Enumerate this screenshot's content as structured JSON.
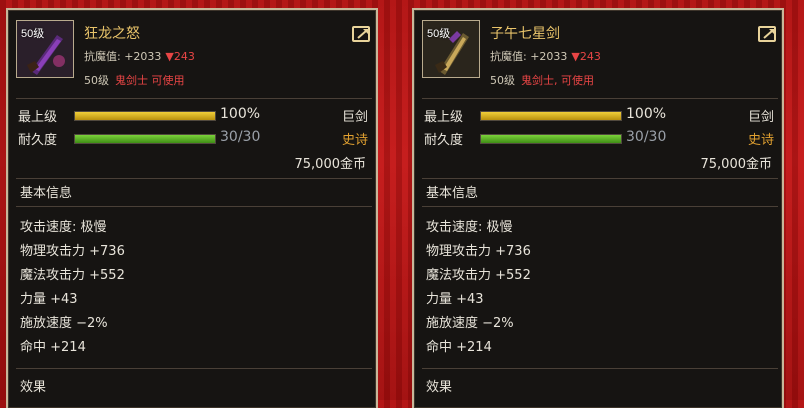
{
  "colors": {
    "name": "#e9c46a",
    "red": "#e84545",
    "bar_yellow": "#d9b21a",
    "bar_green": "#5fb82a",
    "epic": "#e0a030"
  },
  "items": [
    {
      "level_badge": "50级",
      "name": "狂龙之怒",
      "stat_label": "抗魔值: +2033",
      "stat_change": "▼243",
      "req_level": "50级",
      "req_class": "鬼剑士 可使用",
      "top_label": "最上级",
      "top_value": "100%",
      "top_fraction": 1.0,
      "type": "巨剑",
      "dur_label": "耐久度",
      "dur_value": "30/30",
      "dur_fraction": 1.0,
      "rarity": "史诗",
      "price": "75,000金币",
      "basic_title": "基本信息",
      "attrs": [
        "攻击速度: 极慢",
        "物理攻击力 +736",
        "魔法攻击力 +552",
        "力量 +43",
        "施放速度 −2%",
        "命中 +214"
      ],
      "effect_title": "效果",
      "icon": "purple-greatsword-icon"
    },
    {
      "level_badge": "50级",
      "name": "子午七星剑",
      "stat_label": "抗魔值: +2033",
      "stat_change": "▼243",
      "req_level": "50级",
      "req_class": "鬼剑士, 可使用",
      "top_label": "最上级",
      "top_value": "100%",
      "top_fraction": 1.0,
      "type": "巨剑",
      "dur_label": "耐久度",
      "dur_value": "30/30",
      "dur_fraction": 1.0,
      "rarity": "史诗",
      "price": "75,000金币",
      "basic_title": "基本信息",
      "attrs": [
        "攻击速度: 极慢",
        "物理攻击力 +736",
        "魔法攻击力 +552",
        "力量 +43",
        "施放速度 −2%",
        "命中 +214"
      ],
      "effect_title": "效果",
      "icon": "golden-greatsword-icon"
    }
  ]
}
